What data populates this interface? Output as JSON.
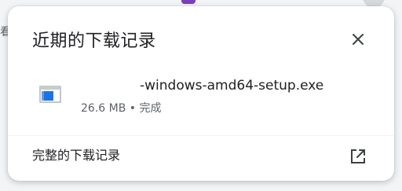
{
  "background": {
    "edge_text": "看",
    "accent_color": "#7b3fbf"
  },
  "panel": {
    "title": "近期的下载记录",
    "close_icon": "close-icon"
  },
  "downloads": [
    {
      "name_suffix": "-windows-amd64-setup.exe",
      "size": "26.6 MB",
      "separator": "•",
      "status": "完成",
      "icon": "exe-file-icon"
    }
  ],
  "footer": {
    "label": "完整的下载记录",
    "icon": "open-in-new-icon"
  },
  "colors": {
    "text_primary": "#202124",
    "text_secondary": "#5f6368",
    "file_icon_blue": "#1a73e8"
  }
}
